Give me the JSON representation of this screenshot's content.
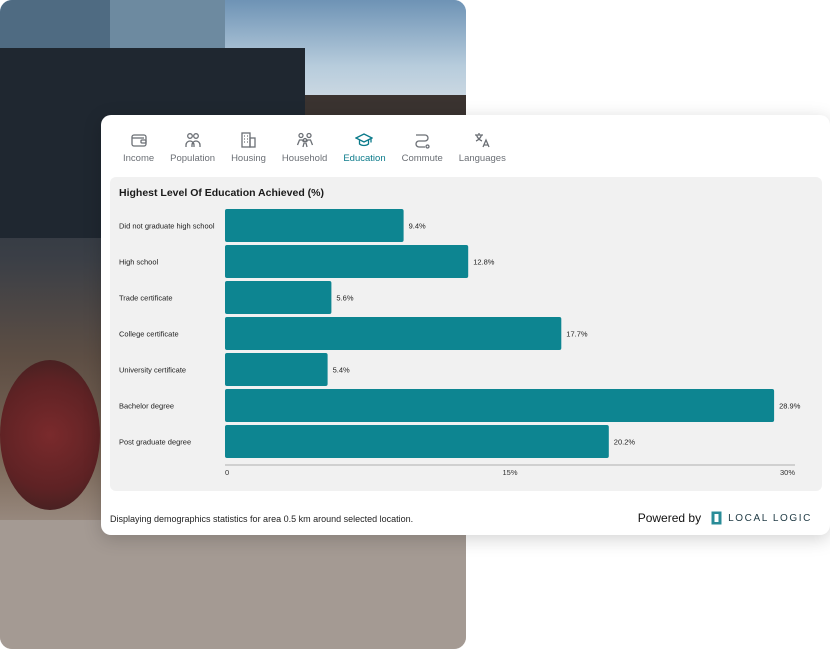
{
  "tabs": [
    {
      "label": "Income",
      "icon": "wallet-icon",
      "active": false
    },
    {
      "label": "Population",
      "icon": "people-icon",
      "active": false
    },
    {
      "label": "Housing",
      "icon": "building-icon",
      "active": false
    },
    {
      "label": "Household",
      "icon": "family-icon",
      "active": false
    },
    {
      "label": "Education",
      "icon": "graduation-cap-icon",
      "active": true
    },
    {
      "label": "Commute",
      "icon": "route-icon",
      "active": false
    },
    {
      "label": "Languages",
      "icon": "translate-icon",
      "active": false
    }
  ],
  "accent_color": "#0a7a8a",
  "bar_color": "#0d8591",
  "footer": {
    "note": "Displaying demographics statistics for area 0.5 km around selected location.",
    "powered_by": "Powered by",
    "brand": "LOCAL LOGIC"
  },
  "chart_data": {
    "type": "bar",
    "orientation": "horizontal",
    "title": "Highest Level Of Education Achieved (%)",
    "categories": [
      "Did not graduate high school",
      "High school",
      "Trade certificate",
      "College certificate",
      "University certificate",
      "Bachelor degree",
      "Post graduate degree"
    ],
    "values": [
      9.4,
      12.8,
      5.6,
      17.7,
      5.4,
      28.9,
      20.2
    ],
    "value_labels": [
      "9.4%",
      "12.8%",
      "5.6%",
      "17.7%",
      "5.4%",
      "28.9%",
      "20.2%"
    ],
    "xlim": [
      0,
      30
    ],
    "xticks": [
      0,
      15,
      30
    ],
    "xtick_labels": [
      "0",
      "15%",
      "30%"
    ],
    "grid": false
  }
}
